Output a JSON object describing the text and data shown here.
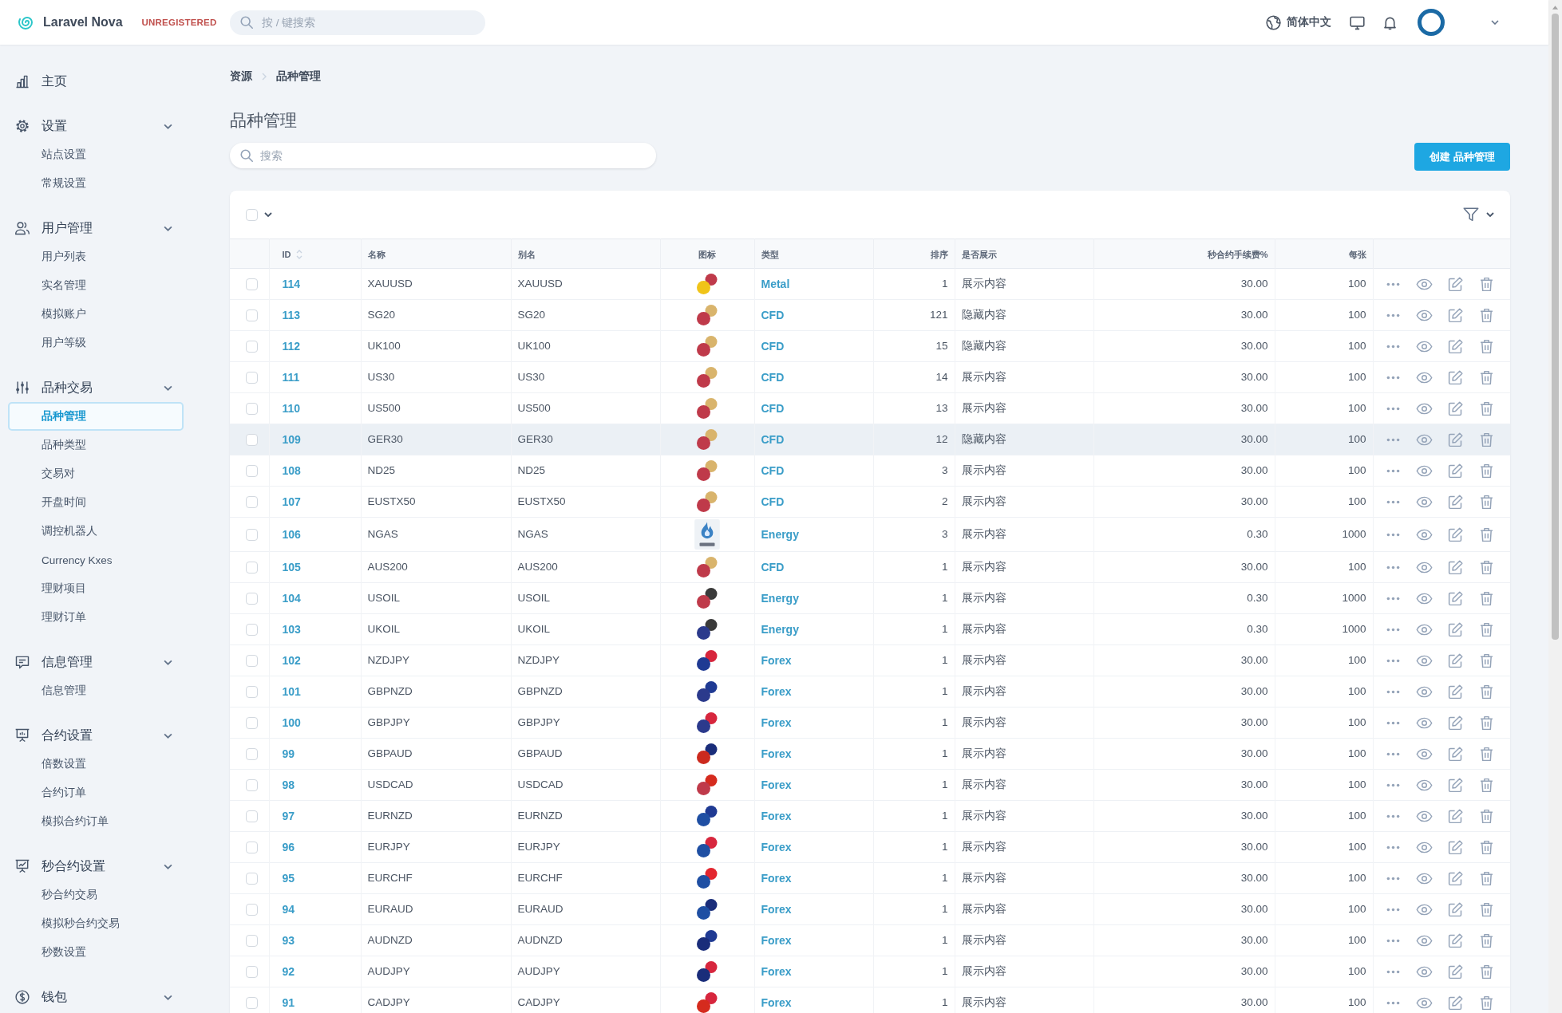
{
  "topbar": {
    "brand": "Laravel Nova",
    "badge": "UNREGISTERED",
    "search": {
      "placeholder": "按 / 键搜索"
    },
    "language": "简体中文"
  },
  "sidebar": {
    "items": [
      {
        "kind": "link",
        "label": "主页"
      },
      {
        "kind": "group",
        "label": "设置",
        "expanded": true,
        "children": [
          {
            "label": "站点设置",
            "selected": false
          },
          {
            "label": "常规设置",
            "selected": false
          }
        ]
      },
      {
        "kind": "group",
        "label": "用户管理",
        "expanded": true,
        "children": [
          {
            "label": "用户列表",
            "selected": false
          },
          {
            "label": "实名管理",
            "selected": false
          },
          {
            "label": "模拟账户",
            "selected": false
          },
          {
            "label": "用户等级",
            "selected": false
          }
        ]
      },
      {
        "kind": "group",
        "label": "品种交易",
        "expanded": true,
        "children": [
          {
            "label": "品种管理",
            "selected": true
          },
          {
            "label": "品种类型",
            "selected": false
          },
          {
            "label": "交易对",
            "selected": false
          },
          {
            "label": "开盘时间",
            "selected": false
          },
          {
            "label": "调控机器人",
            "selected": false
          },
          {
            "label": "Currency Kxes",
            "selected": false
          },
          {
            "label": "理财项目",
            "selected": false
          },
          {
            "label": "理财订单",
            "selected": false
          }
        ]
      },
      {
        "kind": "group",
        "label": "信息管理",
        "expanded": true,
        "children": [
          {
            "label": "信息管理",
            "selected": false
          }
        ]
      },
      {
        "kind": "group",
        "label": "合约设置",
        "expanded": true,
        "children": [
          {
            "label": "倍数设置",
            "selected": false
          },
          {
            "label": "合约订单",
            "selected": false
          },
          {
            "label": "模拟合约订单",
            "selected": false
          }
        ]
      },
      {
        "kind": "group",
        "label": "秒合约设置",
        "expanded": true,
        "children": [
          {
            "label": "秒合约交易",
            "selected": false
          },
          {
            "label": "模拟秒合约交易",
            "selected": false
          },
          {
            "label": "秒数设置",
            "selected": false
          }
        ]
      },
      {
        "kind": "group",
        "label": "钱包",
        "expanded": true
      }
    ]
  },
  "breadcrumb": [
    "资源",
    "品种管理"
  ],
  "title": "品种管理",
  "search": {
    "placeholder": "搜索"
  },
  "create_button": "创建 品种管理",
  "toolbar": {
    "select_all": {
      "checked": false
    }
  },
  "table": {
    "columns": [
      {
        "label": "ID",
        "kind": "id",
        "sortable": true
      },
      {
        "label": "名称",
        "kind": "text",
        "sortable": false
      },
      {
        "label": "别名",
        "kind": "text",
        "sortable": false
      },
      {
        "label": "图标",
        "kind": "icon",
        "sortable": false
      },
      {
        "label": "类型",
        "kind": "link",
        "sortable": false
      },
      {
        "label": "排序",
        "kind": "number",
        "sortable": false
      },
      {
        "label": "是否展示",
        "kind": "text",
        "sortable": false
      },
      {
        "label": "秒合约手续费%",
        "kind": "number",
        "sortable": false
      },
      {
        "label": "每张",
        "kind": "number",
        "sortable": false
      }
    ],
    "rows": [
      {
        "id": "114",
        "name": "XAUUSD",
        "alias": "XAUUSD",
        "icon": {
          "kind": "pair",
          "front": {
            "color": "#f0c419"
          },
          "back": {
            "color": "#bf3a4a"
          }
        },
        "type": "Metal",
        "sort": "1",
        "display": "展示内容",
        "fee": "30.00",
        "per_lot": "100",
        "checked": false,
        "highlighted": false
      },
      {
        "id": "113",
        "name": "SG20",
        "alias": "SG20",
        "icon": {
          "kind": "pair",
          "front": {
            "color": "#bf3a4a"
          },
          "back": {
            "color": "#d9b46c"
          }
        },
        "type": "CFD",
        "sort": "121",
        "display": "隐藏内容",
        "fee": "30.00",
        "per_lot": "100",
        "checked": false,
        "highlighted": false
      },
      {
        "id": "112",
        "name": "UK100",
        "alias": "UK100",
        "icon": {
          "kind": "pair",
          "front": {
            "color": "#bf3a4a"
          },
          "back": {
            "color": "#d9b46c"
          }
        },
        "type": "CFD",
        "sort": "15",
        "display": "隐藏内容",
        "fee": "30.00",
        "per_lot": "100",
        "checked": false,
        "highlighted": false
      },
      {
        "id": "111",
        "name": "US30",
        "alias": "US30",
        "icon": {
          "kind": "pair",
          "front": {
            "color": "#bf3a4a"
          },
          "back": {
            "color": "#d9b46c"
          }
        },
        "type": "CFD",
        "sort": "14",
        "display": "展示内容",
        "fee": "30.00",
        "per_lot": "100",
        "checked": false,
        "highlighted": false
      },
      {
        "id": "110",
        "name": "US500",
        "alias": "US500",
        "icon": {
          "kind": "pair",
          "front": {
            "color": "#bf3a4a"
          },
          "back": {
            "color": "#d9b46c"
          }
        },
        "type": "CFD",
        "sort": "13",
        "display": "展示内容",
        "fee": "30.00",
        "per_lot": "100",
        "checked": false,
        "highlighted": false
      },
      {
        "id": "109",
        "name": "GER30",
        "alias": "GER30",
        "icon": {
          "kind": "pair",
          "front": {
            "color": "#bf3a4a"
          },
          "back": {
            "color": "#d9b46c"
          }
        },
        "type": "CFD",
        "sort": "12",
        "display": "隐藏内容",
        "fee": "30.00",
        "per_lot": "100",
        "checked": false,
        "highlighted": true
      },
      {
        "id": "108",
        "name": "ND25",
        "alias": "ND25",
        "icon": {
          "kind": "pair",
          "front": {
            "color": "#bf3a4a"
          },
          "back": {
            "color": "#d9b46c"
          }
        },
        "type": "CFD",
        "sort": "3",
        "display": "展示内容",
        "fee": "30.00",
        "per_lot": "100",
        "checked": false,
        "highlighted": false
      },
      {
        "id": "107",
        "name": "EUSTX50",
        "alias": "EUSTX50",
        "icon": {
          "kind": "pair",
          "front": {
            "color": "#bf3a4a"
          },
          "back": {
            "color": "#d9b46c"
          }
        },
        "type": "CFD",
        "sort": "2",
        "display": "展示内容",
        "fee": "30.00",
        "per_lot": "100",
        "checked": false,
        "highlighted": false
      },
      {
        "id": "106",
        "name": "NGAS",
        "alias": "NGAS",
        "icon": {
          "kind": "logo"
        },
        "type": "Energy",
        "sort": "3",
        "display": "展示内容",
        "fee": "0.30",
        "per_lot": "1000",
        "checked": false,
        "highlighted": false
      },
      {
        "id": "105",
        "name": "AUS200",
        "alias": "AUS200",
        "icon": {
          "kind": "pair",
          "front": {
            "color": "#bf3a4a"
          },
          "back": {
            "color": "#d9b46c"
          }
        },
        "type": "CFD",
        "sort": "1",
        "display": "展示内容",
        "fee": "30.00",
        "per_lot": "100",
        "checked": false,
        "highlighted": false
      },
      {
        "id": "104",
        "name": "USOIL",
        "alias": "USOIL",
        "icon": {
          "kind": "pair",
          "front": {
            "color": "#bf3a4a"
          },
          "back": {
            "color": "#3a3a3a"
          }
        },
        "type": "Energy",
        "sort": "1",
        "display": "展示内容",
        "fee": "0.30",
        "per_lot": "1000",
        "checked": false,
        "highlighted": false
      },
      {
        "id": "103",
        "name": "UKOIL",
        "alias": "UKOIL",
        "icon": {
          "kind": "pair",
          "front": {
            "color": "#2b3a8c"
          },
          "back": {
            "color": "#3a3a3a"
          }
        },
        "type": "Energy",
        "sort": "1",
        "display": "展示内容",
        "fee": "0.30",
        "per_lot": "1000",
        "checked": false,
        "highlighted": false
      },
      {
        "id": "102",
        "name": "NZDJPY",
        "alias": "NZDJPY",
        "icon": {
          "kind": "pair",
          "front": {
            "color": "#1f3a93"
          },
          "back": {
            "color": "#d7263d"
          }
        },
        "type": "Forex",
        "sort": "1",
        "display": "展示内容",
        "fee": "30.00",
        "per_lot": "100",
        "checked": false,
        "highlighted": false
      },
      {
        "id": "101",
        "name": "GBPNZD",
        "alias": "GBPNZD",
        "icon": {
          "kind": "pair",
          "front": {
            "color": "#2b3a8c"
          },
          "back": {
            "color": "#1f3a93"
          }
        },
        "type": "Forex",
        "sort": "1",
        "display": "展示内容",
        "fee": "30.00",
        "per_lot": "100",
        "checked": false,
        "highlighted": false
      },
      {
        "id": "100",
        "name": "GBPJPY",
        "alias": "GBPJPY",
        "icon": {
          "kind": "pair",
          "front": {
            "color": "#2b3a8c"
          },
          "back": {
            "color": "#d7263d"
          }
        },
        "type": "Forex",
        "sort": "1",
        "display": "展示内容",
        "fee": "30.00",
        "per_lot": "100",
        "checked": false,
        "highlighted": false
      },
      {
        "id": "99",
        "name": "GBPAUD",
        "alias": "GBPAUD",
        "icon": {
          "kind": "pair",
          "front": {
            "color": "#cc2a1e"
          },
          "back": {
            "color": "#1a2d7a"
          }
        },
        "type": "Forex",
        "sort": "1",
        "display": "展示内容",
        "fee": "30.00",
        "per_lot": "100",
        "checked": false,
        "highlighted": false
      },
      {
        "id": "98",
        "name": "USDCAD",
        "alias": "USDCAD",
        "icon": {
          "kind": "pair",
          "front": {
            "color": "#bf3a4a"
          },
          "back": {
            "color": "#d52b1e"
          }
        },
        "type": "Forex",
        "sort": "1",
        "display": "展示内容",
        "fee": "30.00",
        "per_lot": "100",
        "checked": false,
        "highlighted": false
      },
      {
        "id": "97",
        "name": "EURNZD",
        "alias": "EURNZD",
        "icon": {
          "kind": "pair",
          "front": {
            "color": "#1f4fa3"
          },
          "back": {
            "color": "#1f3a93"
          }
        },
        "type": "Forex",
        "sort": "1",
        "display": "展示内容",
        "fee": "30.00",
        "per_lot": "100",
        "checked": false,
        "highlighted": false
      },
      {
        "id": "96",
        "name": "EURJPY",
        "alias": "EURJPY",
        "icon": {
          "kind": "pair",
          "front": {
            "color": "#1f4fa3"
          },
          "back": {
            "color": "#d7263d"
          }
        },
        "type": "Forex",
        "sort": "1",
        "display": "展示内容",
        "fee": "30.00",
        "per_lot": "100",
        "checked": false,
        "highlighted": false
      },
      {
        "id": "95",
        "name": "EURCHF",
        "alias": "EURCHF",
        "icon": {
          "kind": "pair",
          "front": {
            "color": "#1f4fa3"
          },
          "back": {
            "color": "#e3262f"
          }
        },
        "type": "Forex",
        "sort": "1",
        "display": "展示内容",
        "fee": "30.00",
        "per_lot": "100",
        "checked": false,
        "highlighted": false
      },
      {
        "id": "94",
        "name": "EURAUD",
        "alias": "EURAUD",
        "icon": {
          "kind": "pair",
          "front": {
            "color": "#1f4fa3"
          },
          "back": {
            "color": "#1a2d7a"
          }
        },
        "type": "Forex",
        "sort": "1",
        "display": "展示内容",
        "fee": "30.00",
        "per_lot": "100",
        "checked": false,
        "highlighted": false
      },
      {
        "id": "93",
        "name": "AUDNZD",
        "alias": "AUDNZD",
        "icon": {
          "kind": "pair",
          "front": {
            "color": "#1a2d7a"
          },
          "back": {
            "color": "#1f3a93"
          }
        },
        "type": "Forex",
        "sort": "1",
        "display": "展示内容",
        "fee": "30.00",
        "per_lot": "100",
        "checked": false,
        "highlighted": false
      },
      {
        "id": "92",
        "name": "AUDJPY",
        "alias": "AUDJPY",
        "icon": {
          "kind": "pair",
          "front": {
            "color": "#1a2d7a"
          },
          "back": {
            "color": "#d7263d"
          }
        },
        "type": "Forex",
        "sort": "1",
        "display": "展示内容",
        "fee": "30.00",
        "per_lot": "100",
        "checked": false,
        "highlighted": false
      },
      {
        "id": "91",
        "name": "CADJPY",
        "alias": "CADJPY",
        "icon": {
          "kind": "pair",
          "front": {
            "color": "#d52b1e"
          },
          "back": {
            "color": "#d7263d"
          }
        },
        "type": "Forex",
        "sort": "1",
        "display": "展示内容",
        "fee": "30.00",
        "per_lot": "100",
        "checked": false,
        "highlighted": false
      }
    ]
  }
}
